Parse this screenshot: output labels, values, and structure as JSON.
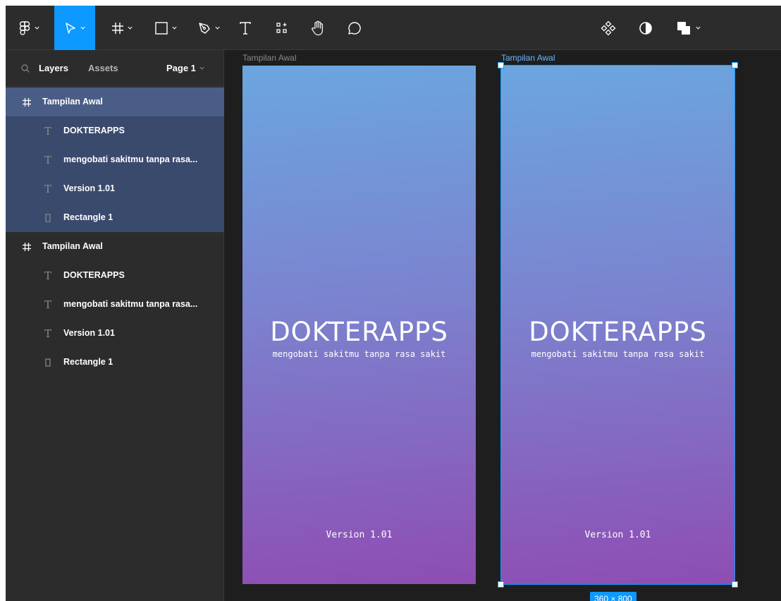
{
  "toolbar": {
    "tools": [
      {
        "name": "main-menu",
        "icon": "figma-logo-icon"
      },
      {
        "name": "move-tool",
        "icon": "move-arrow-icon",
        "active": true
      },
      {
        "name": "frame-tool",
        "icon": "frame-hash-icon"
      },
      {
        "name": "shape-tool",
        "icon": "rectangle-icon"
      },
      {
        "name": "pen-tool",
        "icon": "pen-icon"
      },
      {
        "name": "text-tool",
        "icon": "text-icon"
      },
      {
        "name": "resources-tool",
        "icon": "resources-icon"
      },
      {
        "name": "hand-tool",
        "icon": "hand-icon"
      },
      {
        "name": "comment-tool",
        "icon": "comment-icon"
      },
      {
        "name": "component",
        "icon": "component-icon"
      },
      {
        "name": "mask",
        "icon": "mask-icon"
      },
      {
        "name": "boolean-ops",
        "icon": "boolean-icon"
      }
    ],
    "accent": "#0d99ff"
  },
  "panel": {
    "tab_layers": "Layers",
    "tab_assets": "Assets",
    "page_selector": "Page 1",
    "layers": [
      {
        "frame": "Tampilan Awal",
        "selected": true,
        "children": [
          {
            "type": "text",
            "label": "DOKTERAPPS"
          },
          {
            "type": "text",
            "label": "mengobati sakitmu tanpa rasa..."
          },
          {
            "type": "text",
            "label": "Version 1.01"
          },
          {
            "type": "rect",
            "label": "Rectangle 1"
          }
        ]
      },
      {
        "frame": "Tampilan Awal",
        "selected": false,
        "children": [
          {
            "type": "text",
            "label": "DOKTERAPPS"
          },
          {
            "type": "text",
            "label": "mengobati sakitmu tanpa rasa..."
          },
          {
            "type": "text",
            "label": "Version 1.01"
          },
          {
            "type": "rect",
            "label": "Rectangle 1"
          }
        ]
      }
    ]
  },
  "canvas": {
    "frames": [
      {
        "label": "Tampilan Awal",
        "title": "DOKTERAPPS",
        "subtitle": "mengobati sakitmu tanpa rasa sakit",
        "version": "Version 1.01",
        "selected": false
      },
      {
        "label": "Tampilan Awal",
        "title": "DOKTERAPPS",
        "subtitle": "mengobati sakitmu tanpa rasa sakit",
        "version": "Version 1.01",
        "selected": true
      }
    ],
    "selection_size": "360 × 800",
    "gradient_colors": [
      "#6ba6e0",
      "#7b83cf",
      "#8e4db3"
    ]
  }
}
